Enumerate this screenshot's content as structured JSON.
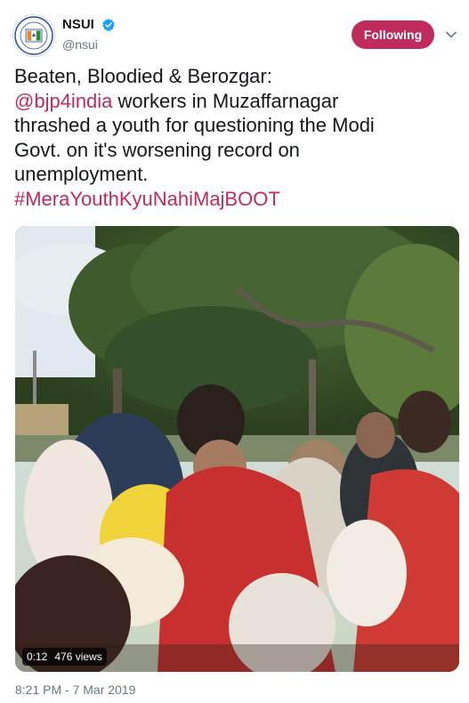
{
  "account": {
    "display_name": "NSUI",
    "handle": "@nsui",
    "follow_label": "Following",
    "avatar_icon": "nsui-logo-icon",
    "verified_icon": "verified-badge-icon"
  },
  "tweet": {
    "line1": "Beaten, Bloodied & Berozgar:",
    "mention": "@bjp4india",
    "line2_rest": " workers in Muzaffarnagar",
    "line3": "thrashed a youth for questioning the Modi",
    "line4": "Govt. on it's worsening record on",
    "line5": "unemployment.",
    "hashtag": "#MeraYouthKyuNahiMajBOOT"
  },
  "media": {
    "duration": "0:12",
    "views": "476 views"
  },
  "timestamp": "8:21 PM - 7 Mar 2019",
  "colors": {
    "accent": "#bf2c5b",
    "secondary_text": "#657786",
    "text": "#14171a",
    "verified": "#1da1f2"
  }
}
